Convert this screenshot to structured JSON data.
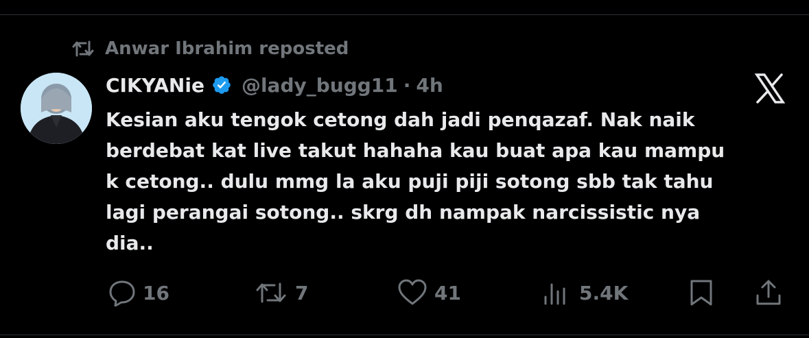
{
  "repost": {
    "icon": "repost-icon",
    "text": "Anwar Ibrahim reposted"
  },
  "tweet": {
    "display_name": "CIKYANie",
    "verified": true,
    "handle": "@lady_bugg11",
    "separator": "·",
    "time": "4h",
    "text": "Kesian aku tengok cetong dah jadi penqazaf. Nak naik\nberdebat kat live takut hahaha kau buat apa kau mampu\nk cetong.. dulu mmg la aku puji piji sotong sbb tak tahu\nlagi perangai sotong.. skrg dh nampak narcissistic nya\ndia..",
    "platform_icon": "x-logo-icon"
  },
  "actions": {
    "replies": {
      "icon": "reply-icon",
      "count": "16"
    },
    "reposts": {
      "icon": "repost-icon",
      "count": "7"
    },
    "likes": {
      "icon": "heart-icon",
      "count": "41"
    },
    "views": {
      "icon": "views-icon",
      "count": "5.4K"
    },
    "bookmark": {
      "icon": "bookmark-icon"
    },
    "share": {
      "icon": "share-icon"
    }
  },
  "colors": {
    "background": "#000000",
    "text_primary": "#e7e9ea",
    "text_secondary": "#71767b",
    "verified_blue": "#1d9bf0"
  }
}
